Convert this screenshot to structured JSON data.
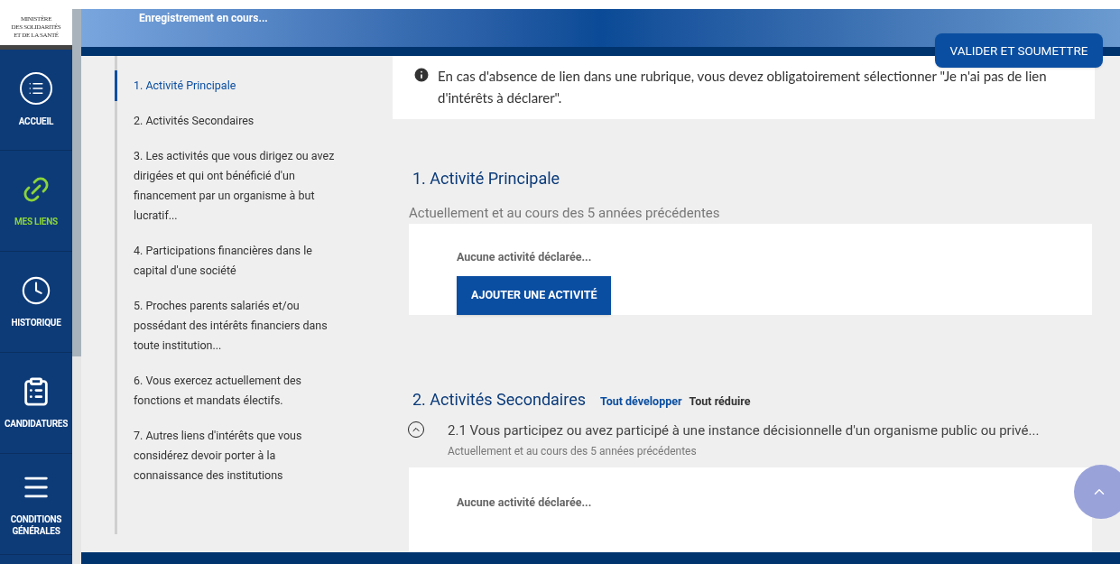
{
  "logo": {
    "lines": [
      "MINISTÈRE",
      "DES SOLIDARITÉS",
      "ET DE LA SANTÉ"
    ]
  },
  "nav": [
    {
      "label": "ACCUEIL",
      "selected": false
    },
    {
      "label": "MES LIENS",
      "selected": true
    },
    {
      "label": "HISTORIQUE",
      "selected": false
    },
    {
      "label": "CANDIDATURES",
      "selected": false
    },
    {
      "label": "CONDITIONS GÉNÉRALES",
      "selected": false
    }
  ],
  "header": {
    "status": "Enregistrement en cours...",
    "submit_button": "VALIDER ET SOUMETTRE"
  },
  "toc": [
    {
      "label": "1. Activité Principale",
      "selected": true
    },
    {
      "label": "2. Activités Secondaires",
      "selected": false
    },
    {
      "label": "3. Les activités que vous dirigez ou avez dirigées et qui ont bénéficié d'un financement par un organisme à but lucratif...",
      "selected": false
    },
    {
      "label": "4. Participations financières dans le capital d'une société",
      "selected": false
    },
    {
      "label": "5. Proches parents salariés et/ou possédant des intérêts financiers dans toute institution...",
      "selected": false
    },
    {
      "label": "6. Vous exercez actuellement des fonctions et mandats électifs.",
      "selected": false
    },
    {
      "label": "7. Autres liens d'intérêts que vous considérez devoir porter à la connaissance des institutions",
      "selected": false
    }
  ],
  "notice": "En cas d'absence de lien dans une rubrique, vous devez obligatoirement sélectionner \"Je n'ai pas de lien d'intérêts à déclarer\".",
  "section1": {
    "title": "1. Activité Principale",
    "subtitle": "Actuellement et au cours des 5 années précédentes",
    "empty": "Aucune activité déclarée...",
    "add_button": "AJOUTER UNE ACTIVITÉ"
  },
  "section2": {
    "title": "2. Activités Secondaires",
    "expand_all": "Tout développer",
    "collapse_all": "Tout réduire",
    "items": [
      {
        "title": "2.1 Vous participez ou avez participé à une instance décisionnelle d'un organisme public ou privé...",
        "subtitle": "Actuellement et au cours des 5 années précédentes",
        "expanded": true,
        "empty": "Aucune activité déclarée..."
      }
    ]
  }
}
